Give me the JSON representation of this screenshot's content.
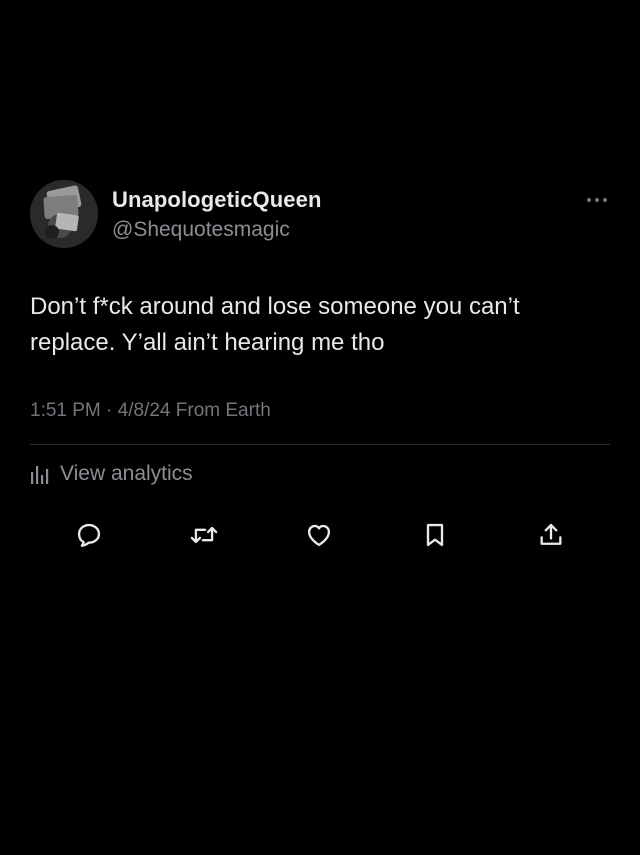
{
  "tweet": {
    "display_name": "UnapologeticQueen",
    "handle": "@Shequotesmagic",
    "text": "Don’t f*ck around and lose someone you can’t replace. Y’all ain’t hearing me tho",
    "time": "1:51 PM",
    "date": "4/8/24",
    "source": "From Earth",
    "meta_separator": "·"
  },
  "analytics": {
    "label": "View analytics",
    "icon": "bar-chart-icon"
  },
  "actions": [
    {
      "icon": "reply-icon"
    },
    {
      "icon": "retweet-icon"
    },
    {
      "icon": "like-icon"
    },
    {
      "icon": "bookmark-icon"
    },
    {
      "icon": "share-icon"
    }
  ],
  "menu": {
    "icon": "more-options-icon"
  },
  "colors": {
    "background": "#000000",
    "primary_text": "#e7e9ea",
    "secondary_text": "#71767b",
    "icon": "#e7e9ea",
    "divider": "#2a2d30"
  }
}
